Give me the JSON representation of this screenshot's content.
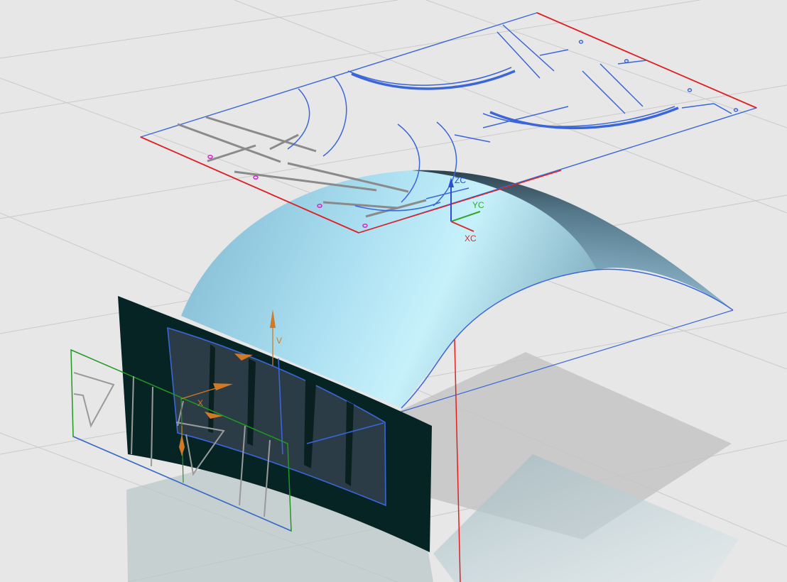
{
  "viewport": {
    "background": "#e6e6e6",
    "grid_color": "#c9c9c9"
  },
  "wcs": {
    "x_label": "XC",
    "y_label": "YC",
    "z_label": "ZC",
    "x_color": "#d43030",
    "y_color": "#2ea82e",
    "z_color": "#2a4fd6"
  },
  "manipulator": {
    "u_label": "X",
    "v_label": "V",
    "handle_color": "#d07a26"
  },
  "colors": {
    "flat_pattern_edge": "#3a66d8",
    "flat_pattern_datum_edge": "#e02020",
    "rib_color": "#8a8a8a",
    "marker_color": "#d22ed2",
    "surface_light": "#c6f1fb",
    "surface_dark": "#1f3440",
    "panel_color": "#062525",
    "sketch_plane": "#1f9a1f"
  }
}
